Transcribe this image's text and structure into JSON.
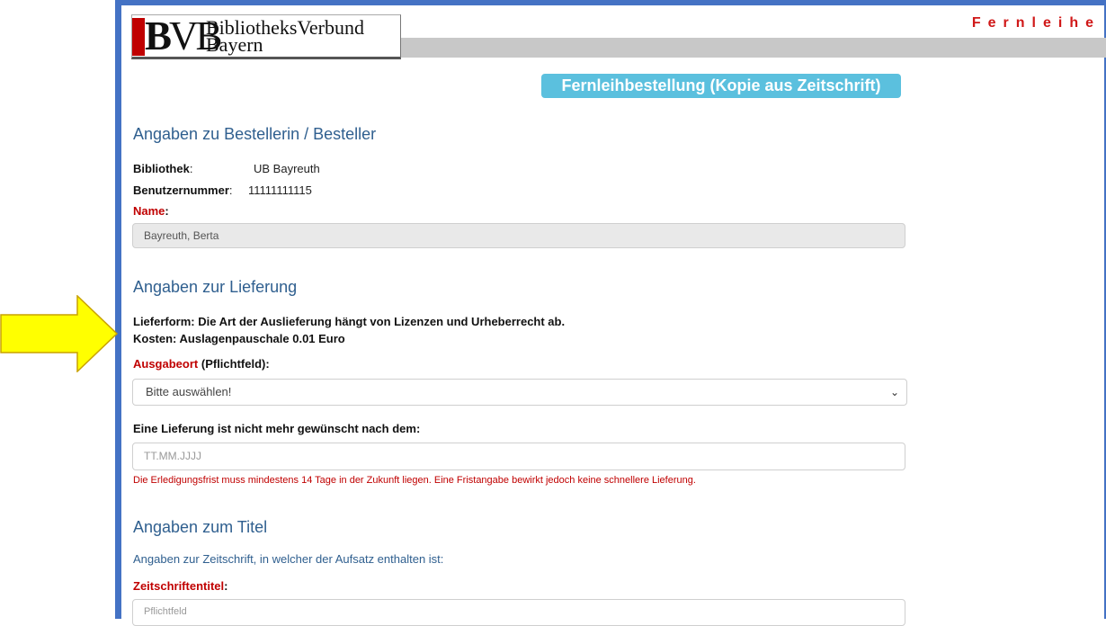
{
  "header": {
    "logo_mark_b": "B",
    "logo_mark_vb": "VB",
    "logo_line1": "BibliotheksVerbund",
    "logo_line2": "Bayern",
    "fernleihe": "Fernleihe"
  },
  "order_title": "Fernleihbestellung (Kopie aus Zeitschrift)",
  "besteller": {
    "heading": "Angaben zu Bestellerin / Besteller",
    "bibliothek_label": "Bibliothek",
    "bibliothek_value": "UB Bayreuth",
    "benutzernummer_label": "Benutzernummer",
    "benutzernummer_value": "11111111115",
    "name_label": "Name",
    "name_value": "Bayreuth, Berta"
  },
  "lieferung": {
    "heading": "Angaben zur Lieferung",
    "lieferform": "Lieferform: Die Art der Auslieferung hängt von Lizenzen und Urheberrecht ab.",
    "kosten": "Kosten: Auslagenpauschale 0.01 Euro",
    "ausgabeort_label": "Ausgabeort",
    "ausgabeort_suffix": "(Pflichtfeld):",
    "ausgabeort_selected": "Bitte auswählen!",
    "deadline_label": "Eine Lieferung ist nicht mehr gewünscht nach dem:",
    "deadline_placeholder": "TT.MM.JJJJ",
    "deadline_hint": "Die Erledigungsfrist muss mindestens 14 Tage in der Zukunft liegen. Eine Fristangabe bewirkt jedoch keine schnellere Lieferung."
  },
  "titel": {
    "heading": "Angaben zum Titel",
    "info": "Angaben zur Zeitschrift, in welcher der Aufsatz enthalten ist:",
    "zeitschrift_label": "Zeitschriftentitel",
    "zeitschrift_placeholder": "Pflichtfeld"
  },
  "colors": {
    "frame": "#4472c4",
    "accent_button": "#5bc0de",
    "required_red": "#c00000",
    "heading_blue": "#2f5f8f",
    "arrow_fill": "#ffff00",
    "arrow_stroke": "#c9a200"
  },
  "icons": {
    "arrow": "right-arrow-annotation",
    "select": "chevron-down-icon"
  }
}
